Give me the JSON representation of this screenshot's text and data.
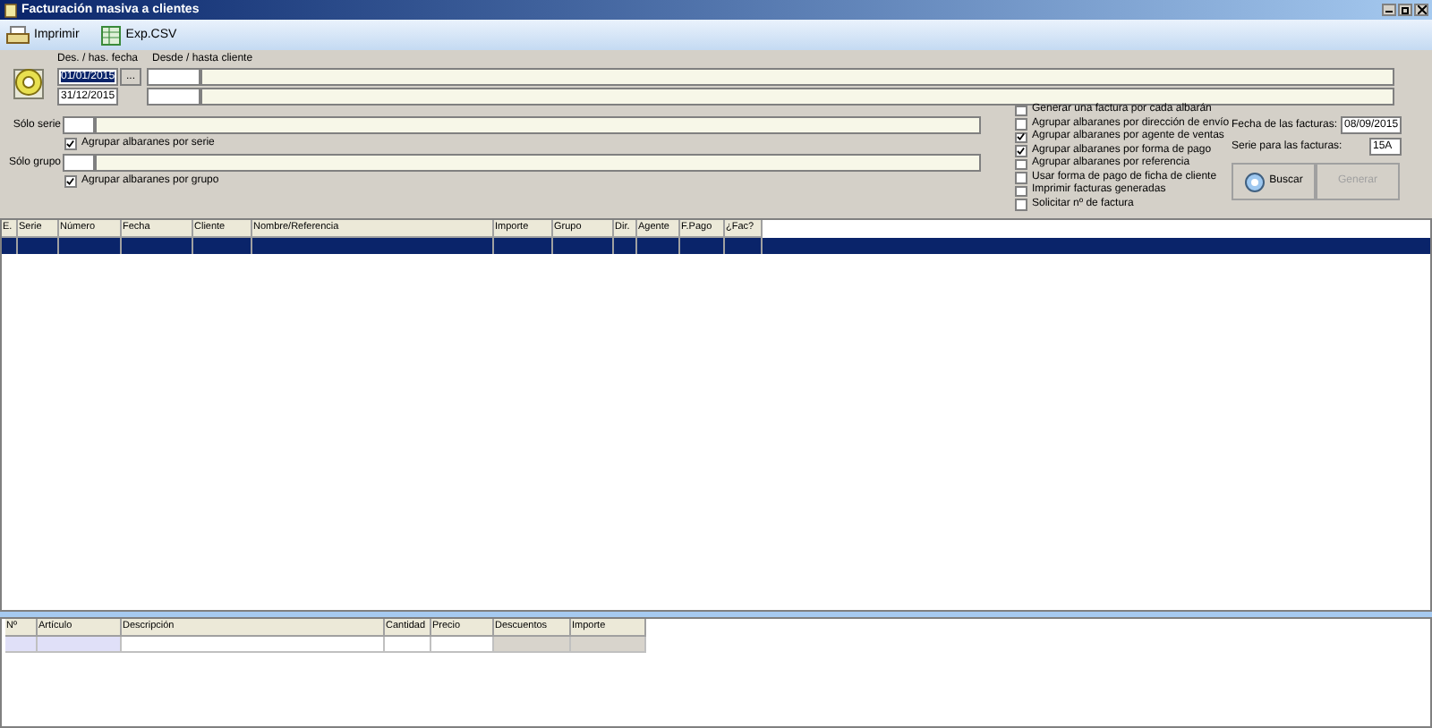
{
  "window": {
    "title": "Facturación masiva a clientes"
  },
  "toolbar": [
    {
      "label": "Imprimir",
      "kind": "print"
    },
    {
      "label": "Exp.CSV",
      "kind": "csv"
    }
  ],
  "filters": {
    "date_label": "Des. / has. fecha",
    "client_label": "Desde / hasta cliente",
    "date_from": "01/01/2015",
    "date_to": "31/12/2015",
    "date_button": "...",
    "serie_label": "Sólo serie",
    "grupo_label": "Sólo grupo"
  },
  "group_checks": [
    {
      "label": "Agrupar albaranes por serie",
      "checked": true
    },
    {
      "label": "Agrupar albaranes por grupo",
      "checked": true
    }
  ],
  "options": [
    {
      "label": "Generar una factura por cada albarán",
      "checked": false
    },
    {
      "label": "Agrupar albaranes por dirección de envío",
      "checked": false
    },
    {
      "label": "Agrupar albaranes por agente de ventas",
      "checked": true
    },
    {
      "label": "Agrupar albaranes por forma de pago",
      "checked": true
    },
    {
      "label": "Agrupar albaranes por referencia",
      "checked": false
    },
    {
      "label": "Usar forma de pago de ficha de cliente",
      "checked": false
    },
    {
      "label": "Imprimir facturas generadas",
      "checked": false
    },
    {
      "label": "Solicitar nº de factura",
      "checked": false
    }
  ],
  "invoice": {
    "date_label": "Fecha de las facturas:",
    "date": "08/09/2015",
    "serie_label": "Serie para las facturas:",
    "serie": "15A"
  },
  "buttons": [
    {
      "label": "Buscar",
      "disabled": false,
      "kind": "search"
    },
    {
      "label": "Generar",
      "disabled": true,
      "kind": "plain"
    }
  ],
  "table": {
    "columns": [
      "E.",
      "Serie",
      "Número",
      "Fecha",
      "Cliente",
      "Nombre/Referencia",
      "Importe",
      "Grupo",
      "Dir.",
      "Agente",
      "F.Pago",
      "¿Fac?"
    ],
    "rows": [
      {
        "selected": true
      }
    ]
  },
  "detail_table": {
    "columns": [
      "Nº",
      "Artículo",
      "Descripción",
      "Cantidad",
      "Precio",
      "Descuentos",
      "Importe"
    ]
  }
}
